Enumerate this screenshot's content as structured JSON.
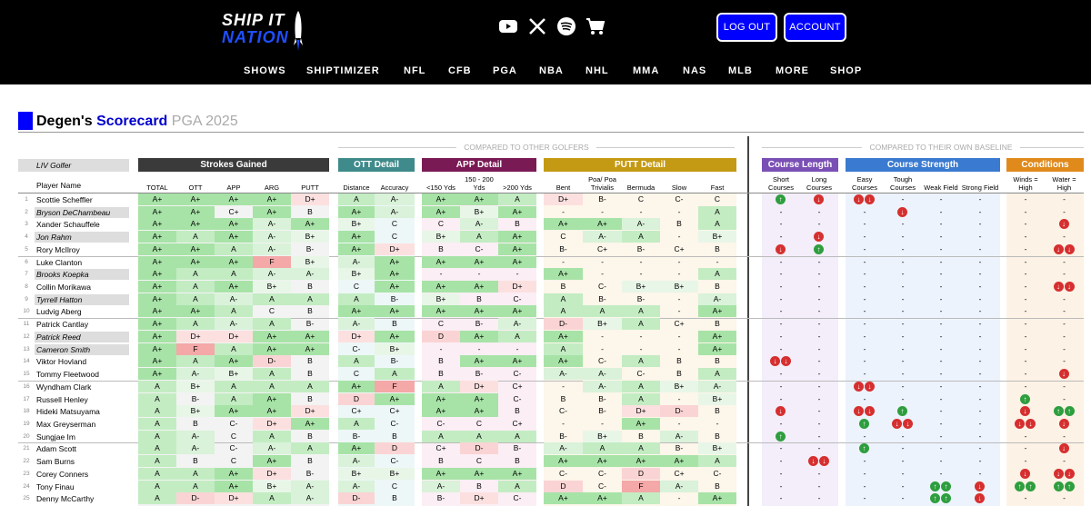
{
  "header": {
    "logo_line1": "SHIP IT",
    "logo_line2": "NATION",
    "social_icons": [
      "youtube-icon",
      "x-icon",
      "spotify-icon",
      "cart-icon"
    ],
    "logout_label": "LOG OUT",
    "account_label": "ACCOUNT",
    "nav": [
      "SHOWS",
      "SHIPTIMIZER",
      "NFL",
      "CFB",
      "PGA",
      "NBA",
      "NHL",
      "MMA",
      "NAS",
      "MLB",
      "MORE",
      "SHOP"
    ]
  },
  "page": {
    "title_part1": "Degen's",
    "title_part2": "Scorecard",
    "title_part3": "PGA 2025",
    "compared_golfers": "COMPARED TO OTHER GOLFERS",
    "compared_baseline": "COMPARED TO THEIR OWN BASELINE",
    "liv_label": "LIV Golfer",
    "player_name_header": "Player Name"
  },
  "groups": [
    {
      "label": "Strokes Gained",
      "color": "#3a3a3a"
    },
    {
      "label": "OTT Detail",
      "color": "#3f8a8a"
    },
    {
      "label": "APP Detail",
      "color": "#7a1a55"
    },
    {
      "label": "PUTT Detail",
      "color": "#c49a14"
    },
    {
      "label": "Course Length",
      "color": "#7a4fb5"
    },
    {
      "label": "Course Strength",
      "color": "#3a7ad0"
    },
    {
      "label": "Conditions",
      "color": "#e08a1c"
    }
  ],
  "columns": [
    "TOTAL",
    "OTT",
    "APP",
    "ARG",
    "PUTT",
    "Distance",
    "Accuracy",
    "<150 Yds",
    "150 - 200 Yds",
    "200 Yds",
    "Bent",
    "Poa/ Poa Trivialis",
    "Bermuda",
    "Slow",
    "Fast",
    "Short Courses",
    "Long Courses",
    "Easy Courses",
    "Tough Courses",
    "Weak Field",
    "Strong Field",
    "Winds = High",
    "Water = High"
  ],
  "columns_prefix_200": ">",
  "players": [
    {
      "n": "1",
      "name": "Scottie Scheffler",
      "liv": false,
      "g": [
        "A+",
        "A+",
        "A+",
        "A+",
        "D+",
        "A",
        "A-",
        "A+",
        "A+",
        "A",
        "D+",
        "B-",
        "C",
        "C-",
        "C"
      ],
      "c": [
        "u",
        "d",
        "dd",
        "",
        "",
        "",
        "",
        ""
      ]
    },
    {
      "n": "2",
      "name": "Bryson DeChambeau",
      "liv": true,
      "g": [
        "A+",
        "A+",
        "C+",
        "A+",
        "B",
        "A+",
        "A-",
        "A+",
        "B+",
        "A+",
        "-",
        "-",
        "-",
        "-",
        "A"
      ],
      "c": [
        "",
        "",
        "",
        "d",
        "",
        "",
        "",
        ""
      ]
    },
    {
      "n": "3",
      "name": "Xander Schauffele",
      "liv": false,
      "g": [
        "A+",
        "A+",
        "A+",
        "A-",
        "A+",
        "B+",
        "C",
        "C",
        "A-",
        "B",
        "A+",
        "A+",
        "A-",
        "B",
        "A"
      ],
      "c": [
        "",
        "",
        "",
        "",
        "",
        "",
        "",
        "d"
      ]
    },
    {
      "n": "4",
      "name": "Jon Rahm",
      "liv": true,
      "g": [
        "A+",
        "A",
        "A+",
        "A-",
        "B+",
        "A+",
        "C",
        "B+",
        "A",
        "A+",
        "C",
        "A-",
        "A",
        "-",
        "B+"
      ],
      "c": [
        "",
        "d",
        "",
        "",
        "",
        "",
        "",
        ""
      ]
    },
    {
      "n": "5",
      "name": "Rory McIlroy",
      "liv": false,
      "g": [
        "A+",
        "A+",
        "A",
        "A-",
        "B-",
        "A+",
        "D+",
        "B",
        "C-",
        "A+",
        "B-",
        "C+",
        "B-",
        "C+",
        "B"
      ],
      "c": [
        "d",
        "u",
        "",
        "",
        "",
        "",
        "",
        "dd"
      ]
    },
    {
      "n": "6",
      "name": "Luke Clanton",
      "liv": false,
      "g": [
        "A+",
        "A+",
        "A+",
        "F",
        "B+",
        "A-",
        "A+",
        "A+",
        "A+",
        "A+",
        "-",
        "-",
        "-",
        "-",
        "-"
      ],
      "c": [
        "",
        "",
        "",
        "",
        "",
        "",
        "",
        ""
      ]
    },
    {
      "n": "7",
      "name": "Brooks Koepka",
      "liv": true,
      "g": [
        "A+",
        "A",
        "A",
        "A-",
        "A-",
        "B+",
        "A+",
        "-",
        "-",
        "-",
        "A+",
        "-",
        "-",
        "-",
        "A"
      ],
      "c": [
        "",
        "",
        "",
        "",
        "",
        "",
        "",
        ""
      ]
    },
    {
      "n": "8",
      "name": "Collin Morikawa",
      "liv": false,
      "g": [
        "A+",
        "A",
        "A+",
        "B+",
        "B",
        "C",
        "A+",
        "A+",
        "A+",
        "D+",
        "B",
        "C-",
        "B+",
        "B+",
        "B"
      ],
      "c": [
        "",
        "",
        "",
        "",
        "",
        "",
        "",
        "dd"
      ]
    },
    {
      "n": "9",
      "name": "Tyrrell Hatton",
      "liv": true,
      "g": [
        "A+",
        "A",
        "A-",
        "A",
        "A",
        "A",
        "B-",
        "B+",
        "B",
        "C-",
        "A",
        "B-",
        "B-",
        "-",
        "A-"
      ],
      "c": [
        "",
        "",
        "",
        "",
        "",
        "",
        "",
        ""
      ]
    },
    {
      "n": "10",
      "name": "Ludvig Aberg",
      "liv": false,
      "g": [
        "A+",
        "A+",
        "A",
        "C",
        "B",
        "A+",
        "A+",
        "A+",
        "A+",
        "A+",
        "A",
        "A",
        "A",
        "-",
        "A+"
      ],
      "c": [
        "",
        "",
        "",
        "",
        "",
        "",
        "",
        ""
      ]
    },
    {
      "n": "11",
      "name": "Patrick Cantlay",
      "liv": false,
      "g": [
        "A+",
        "A",
        "A-",
        "A",
        "B-",
        "A-",
        "B",
        "C",
        "B-",
        "A-",
        "D-",
        "B+",
        "A",
        "C+",
        "B"
      ],
      "c": [
        "",
        "",
        "",
        "",
        "",
        "",
        "",
        ""
      ]
    },
    {
      "n": "12",
      "name": "Patrick Reed",
      "liv": true,
      "g": [
        "A+",
        "D+",
        "D+",
        "A+",
        "A+",
        "D+",
        "A+",
        "D",
        "A+",
        "A",
        "A+",
        "-",
        "-",
        "-",
        "A+"
      ],
      "c": [
        "",
        "",
        "",
        "",
        "",
        "",
        "",
        ""
      ]
    },
    {
      "n": "13",
      "name": "Cameron Smith",
      "liv": true,
      "g": [
        "A+",
        "F",
        "A",
        "A+",
        "A+",
        "C-",
        "B+",
        "-",
        "-",
        "-",
        "A",
        "-",
        "-",
        "-",
        "A+"
      ],
      "c": [
        "",
        "",
        "",
        "",
        "",
        "",
        "",
        ""
      ]
    },
    {
      "n": "14",
      "name": "Viktor Hovland",
      "liv": false,
      "g": [
        "A+",
        "A",
        "A+",
        "D-",
        "B",
        "A",
        "B-",
        "B",
        "A+",
        "A+",
        "A+",
        "C-",
        "A",
        "B",
        "B"
      ],
      "c": [
        "dd",
        "",
        "",
        "",
        "",
        "",
        "",
        ""
      ]
    },
    {
      "n": "15",
      "name": "Tommy Fleetwood",
      "liv": false,
      "g": [
        "A+",
        "A-",
        "B+",
        "A",
        "B",
        "C",
        "A",
        "B",
        "B-",
        "C-",
        "A-",
        "A-",
        "C-",
        "B",
        "A"
      ],
      "c": [
        "",
        "",
        "",
        "",
        "",
        "",
        "",
        "d"
      ]
    },
    {
      "n": "16",
      "name": "Wyndham Clark",
      "liv": false,
      "g": [
        "A",
        "B+",
        "A",
        "A",
        "A",
        "A+",
        "F",
        "A",
        "D+",
        "C+",
        "-",
        "A-",
        "A",
        "B+",
        "A-"
      ],
      "c": [
        "",
        "",
        "dd",
        "",
        "",
        "",
        "",
        ""
      ]
    },
    {
      "n": "17",
      "name": "Russell Henley",
      "liv": false,
      "g": [
        "A",
        "B-",
        "A",
        "A+",
        "B",
        "D",
        "A+",
        "A+",
        "A+",
        "C-",
        "B",
        "B-",
        "A",
        "-",
        "B+"
      ],
      "c": [
        "",
        "",
        "",
        "",
        "",
        "",
        "u",
        ""
      ]
    },
    {
      "n": "18",
      "name": "Hideki Matsuyama",
      "liv": false,
      "g": [
        "A",
        "B+",
        "A+",
        "A+",
        "D+",
        "C+",
        "C+",
        "A+",
        "A+",
        "B",
        "C-",
        "B-",
        "D+",
        "D-",
        "B"
      ],
      "c": [
        "d",
        "",
        "dd",
        "u",
        "",
        "",
        "d",
        "uu"
      ]
    },
    {
      "n": "19",
      "name": "Max Greyserman",
      "liv": false,
      "g": [
        "A",
        "B",
        "C-",
        "D+",
        "A+",
        "A",
        "C-",
        "C-",
        "C",
        "C+",
        "-",
        "-",
        "A+",
        "-",
        "-"
      ],
      "c": [
        "",
        "",
        "u",
        "dd",
        "",
        "",
        "dd",
        "d"
      ]
    },
    {
      "n": "20",
      "name": "Sungjae Im",
      "liv": false,
      "g": [
        "A",
        "A-",
        "C",
        "A",
        "B",
        "B-",
        "B",
        "A",
        "A",
        "A",
        "B-",
        "B+",
        "B",
        "A-",
        "B"
      ],
      "c": [
        "u",
        "",
        "",
        "",
        "",
        "",
        "",
        ""
      ]
    },
    {
      "n": "21",
      "name": "Adam Scott",
      "liv": false,
      "g": [
        "A",
        "A-",
        "C-",
        "A-",
        "A",
        "A+",
        "D",
        "C+",
        "D-",
        "B-",
        "A-",
        "A",
        "A",
        "B-",
        "B+"
      ],
      "c": [
        "",
        "",
        "u",
        "",
        "",
        "",
        "",
        "d"
      ]
    },
    {
      "n": "22",
      "name": "Sam Burns",
      "liv": false,
      "g": [
        "A",
        "B",
        "C",
        "A+",
        "B",
        "A-",
        "C-",
        "B",
        "C",
        "B",
        "A+",
        "A+",
        "A+",
        "A+",
        "A"
      ],
      "c": [
        "",
        "dd",
        "",
        "",
        "",
        "",
        "",
        ""
      ]
    },
    {
      "n": "23",
      "name": "Corey Conners",
      "liv": false,
      "g": [
        "A",
        "A",
        "A+",
        "D+",
        "B-",
        "B+",
        "B+",
        "A+",
        "A+",
        "A+",
        "C-",
        "C-",
        "D",
        "C+",
        "C-"
      ],
      "c": [
        "",
        "",
        "",
        "",
        "",
        "",
        "d",
        "dd"
      ]
    },
    {
      "n": "24",
      "name": "Tony Finau",
      "liv": false,
      "g": [
        "A",
        "A",
        "A+",
        "B+",
        "A-",
        "A-",
        "C",
        "A-",
        "B",
        "A",
        "D",
        "C-",
        "F",
        "A-",
        "B"
      ],
      "c": [
        "",
        "",
        "",
        "",
        "uu",
        "d",
        "uu",
        "uu"
      ]
    },
    {
      "n": "25",
      "name": "Denny McCarthy",
      "liv": false,
      "g": [
        "A",
        "D-",
        "D+",
        "A",
        "A-",
        "D-",
        "B",
        "B-",
        "D+",
        "C-",
        "A+",
        "A+",
        "A",
        "-",
        "A+"
      ],
      "c": [
        "",
        "",
        "",
        "",
        "uu",
        "d",
        "",
        ""
      ]
    }
  ]
}
